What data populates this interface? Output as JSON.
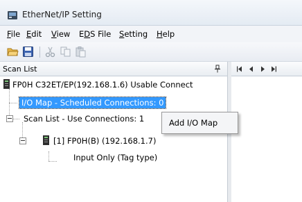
{
  "window": {
    "title": "EtherNet/IP Setting"
  },
  "menubar": {
    "items": [
      {
        "acc": "F",
        "rest": "ile"
      },
      {
        "acc": "E",
        "rest": "dit"
      },
      {
        "acc": "V",
        "rest": "iew"
      },
      {
        "pre": "E",
        "acc": "D",
        "rest": "S File"
      },
      {
        "acc": "S",
        "rest": "etting"
      },
      {
        "acc": "H",
        "rest": "elp"
      }
    ]
  },
  "toolbar": {
    "buttons": [
      "open-folder-icon",
      "save-icon",
      "cut-icon",
      "copy-icon",
      "paste-icon"
    ]
  },
  "scan_list": {
    "title": "Scan List",
    "root": "FP0H C32ET/EP(192.168.1.6)  Usable Connect",
    "io_map": "I/O Map - Scheduled Connections: 0",
    "scan_list_node": "Scan List - Use Connections: 1",
    "device": "[1]  FP0H(B) (192.168.1.7)",
    "device_child": "Input Only (Tag type)"
  },
  "context_menu": {
    "items": [
      "Add I/O Map"
    ]
  },
  "colors": {
    "selection": "#3399ff",
    "titlebar": "#e4ebf3"
  }
}
